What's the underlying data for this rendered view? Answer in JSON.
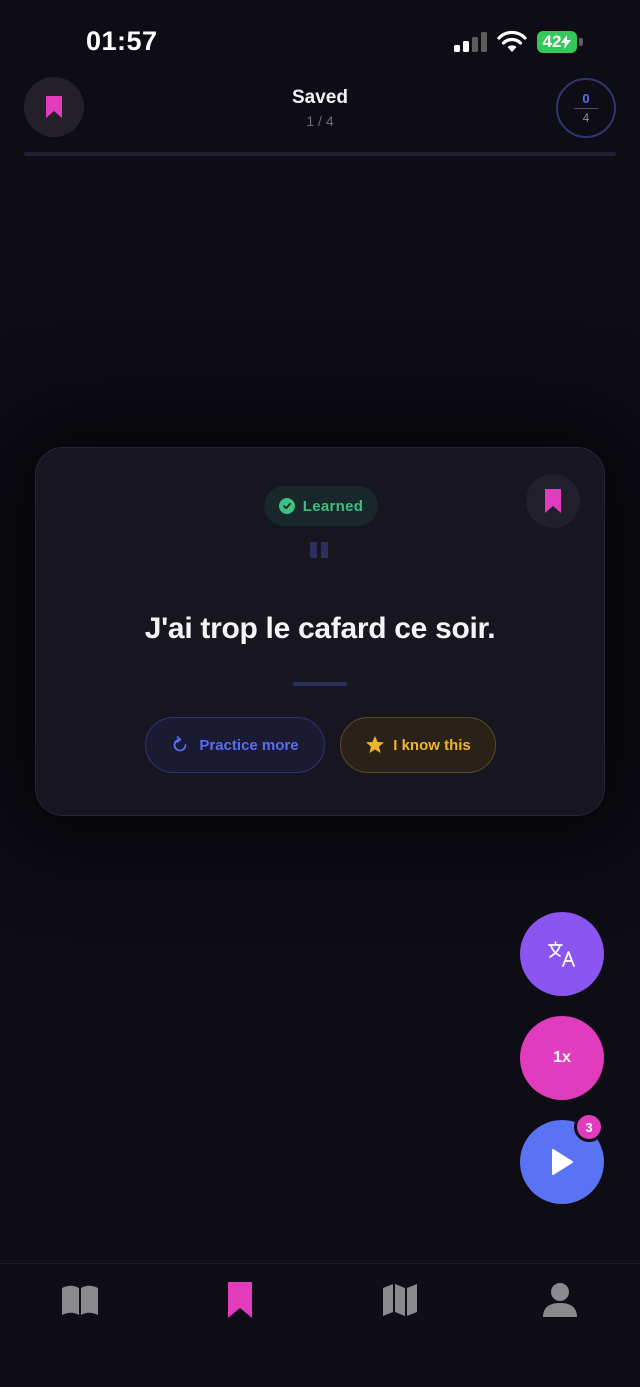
{
  "status_bar": {
    "time": "01:57",
    "battery": "42"
  },
  "header": {
    "title": "Saved",
    "counter": "1 / 4",
    "progress_ring": {
      "done": "0",
      "total": "4"
    }
  },
  "card": {
    "badge": "Learned",
    "sentence": "J'ai trop le cafard ce soir.",
    "practice_button": "Practice more",
    "know_button": "I know this"
  },
  "fabs": {
    "speed_label": "1x",
    "play_badge": "3"
  },
  "tabs": [
    {
      "name": "library",
      "icon": "book-icon",
      "active": false
    },
    {
      "name": "saved",
      "icon": "bookmark-icon",
      "active": true
    },
    {
      "name": "map",
      "icon": "map-icon",
      "active": false
    },
    {
      "name": "profile",
      "icon": "user-icon",
      "active": false
    }
  ],
  "colors": {
    "accent_pink": "#e23cbe",
    "accent_blue": "#5a72f4",
    "accent_purple": "#8a55f0",
    "learned_green": "#3fbf80",
    "gold": "#f0b52a",
    "background": "#0e0c14"
  }
}
